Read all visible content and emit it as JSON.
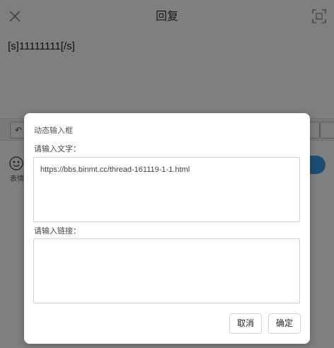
{
  "header": {
    "title": "回复",
    "close_icon": "close-icon",
    "expand_icon": "fullscreen-icon"
  },
  "editor": {
    "content": "[s]11111111[/s]"
  },
  "toolbar": {
    "undo_icon": "undo-icon"
  },
  "bottom": {
    "emoji_label": "表情",
    "send_color": "#3d9be9"
  },
  "dialog": {
    "title": "动态输入框",
    "text_label": "请输入文字：",
    "text_value": "https://bbs.binmt.cc/thread-161119-1-1.html",
    "link_label": "请输入链接：",
    "link_value": "",
    "cancel_label": "取消",
    "confirm_label": "确定"
  }
}
